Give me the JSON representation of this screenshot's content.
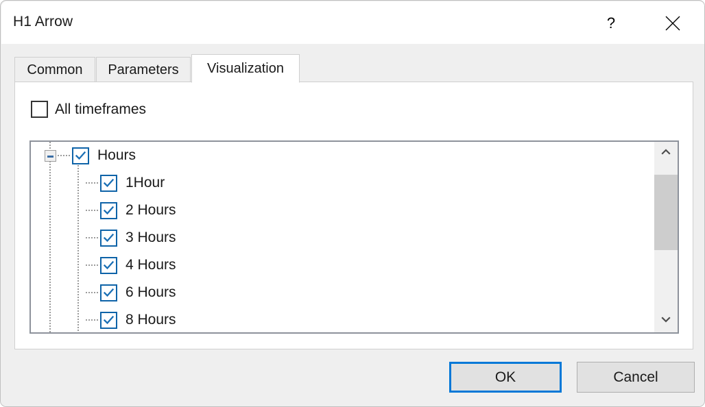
{
  "window": {
    "title": "H1 Arrow",
    "help_icon": "question-mark-icon",
    "close_icon": "close-icon"
  },
  "tabs": [
    {
      "id": "common",
      "label": "Common",
      "active": false
    },
    {
      "id": "parameters",
      "label": "Parameters",
      "active": false
    },
    {
      "id": "visualization",
      "label": "Visualization",
      "active": true
    }
  ],
  "visualization": {
    "all_timeframes": {
      "label": "All timeframes",
      "checked": false
    },
    "tree": {
      "root": {
        "label": "Hours",
        "checked": true,
        "expanded": true,
        "expander_icon": "minus-icon"
      },
      "children": [
        {
          "label": "1Hour",
          "checked": true
        },
        {
          "label": "2 Hours",
          "checked": true
        },
        {
          "label": "3 Hours",
          "checked": true
        },
        {
          "label": "4 Hours",
          "checked": true
        },
        {
          "label": "6 Hours",
          "checked": true
        },
        {
          "label": "8 Hours",
          "checked": true
        }
      ],
      "scrollbar": {
        "up_icon": "chevron-up-icon",
        "down_icon": "chevron-down-icon"
      }
    }
  },
  "footer": {
    "ok_label": "OK",
    "cancel_label": "Cancel"
  },
  "colors": {
    "accent": "#0078d7",
    "checkbox_border": "#0e63a8",
    "check_mark": "#1a6fb5",
    "window_bg": "#efefef",
    "panel_bg": "#ffffff",
    "tree_border": "#8d929b",
    "scroll_thumb": "#cdcdcd"
  }
}
